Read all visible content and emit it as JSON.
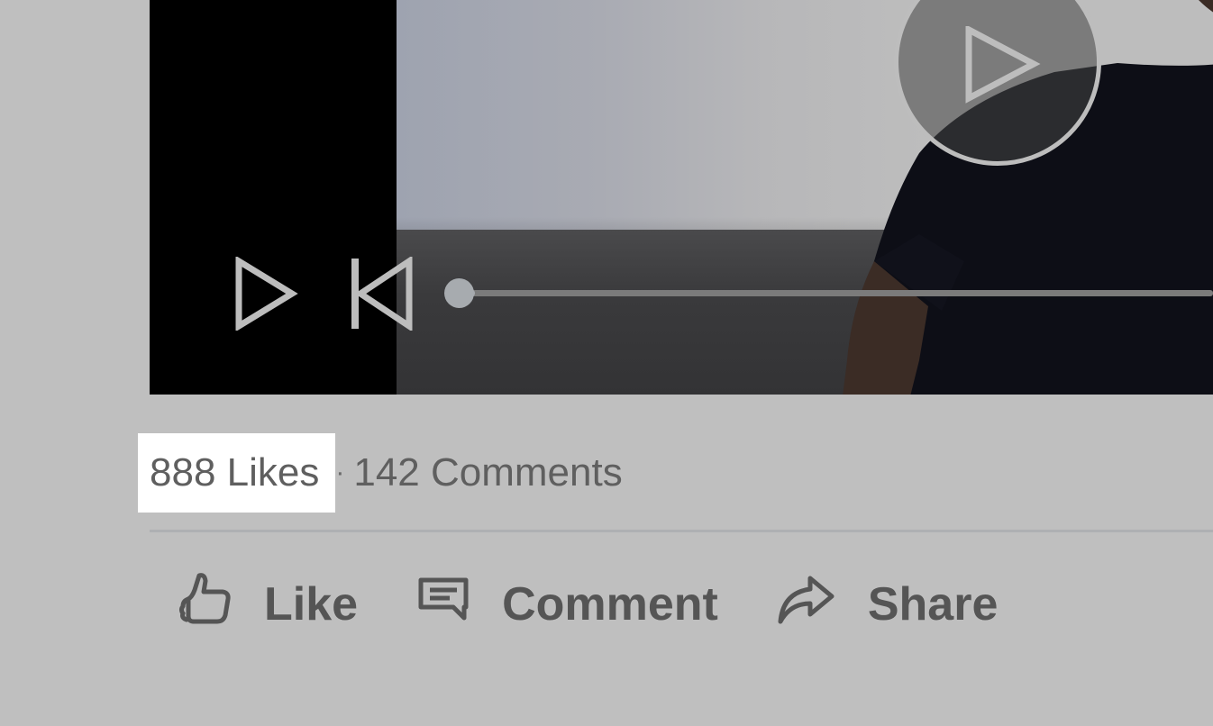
{
  "video": {
    "progress_fraction": 0.02,
    "icons": {
      "center": "play-icon",
      "play": "play-icon",
      "restart": "skip-back-icon"
    }
  },
  "stats": {
    "likes": "888 Likes",
    "separator": "·",
    "comments": "142 Comments"
  },
  "actions": {
    "like_label": "Like",
    "comment_label": "Comment",
    "share_label": "Share",
    "icons": {
      "like": "thumbs-up-icon",
      "comment": "comment-icon",
      "share": "share-arrow-icon"
    }
  },
  "colors": {
    "background": "#bfbfbf",
    "highlight": "#ffffff",
    "text": "#555555",
    "divider": "#aeb0b3"
  }
}
